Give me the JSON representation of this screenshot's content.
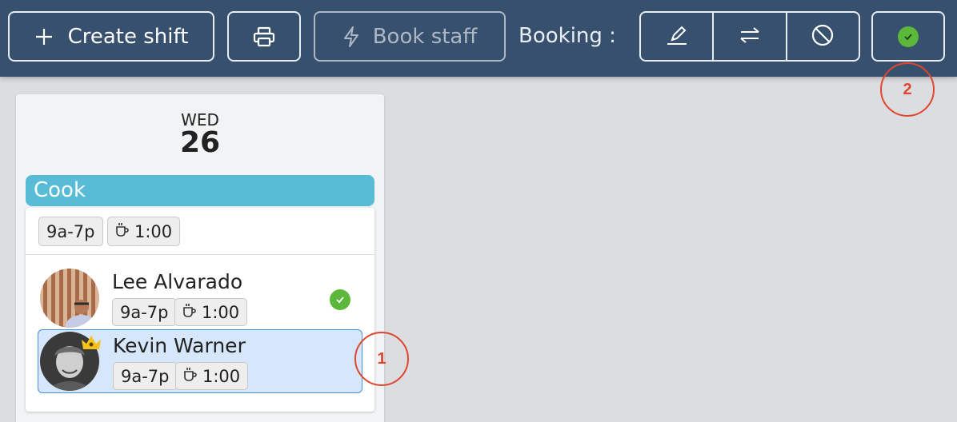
{
  "toolbar": {
    "create_label": "Create shift",
    "book_label": "Book staff",
    "booking_label": "Booking :",
    "icons": {
      "create": "plus-icon",
      "print": "printer-icon",
      "book": "lightning-icon",
      "edit": "pencil-icon",
      "swap": "swap-arrows-icon",
      "cancel": "prohibited-icon",
      "confirm": "check-circle-icon"
    },
    "colors": {
      "bar": "#37506e",
      "confirm": "#5cb83a"
    }
  },
  "annotations": [
    "1",
    "2"
  ],
  "day": {
    "dow": "WED",
    "date": "26"
  },
  "shift": {
    "role": "Cook",
    "role_color": "#58bcd6",
    "time": "9a-7p",
    "break": "1:00",
    "people": [
      {
        "name": "Lee Alvarado",
        "time": "9a-7p",
        "break": "1:00",
        "status": "confirmed"
      },
      {
        "name": "Kevin Warner",
        "time": "9a-7p",
        "break": "1:00",
        "selected": true,
        "lead": true
      }
    ]
  }
}
